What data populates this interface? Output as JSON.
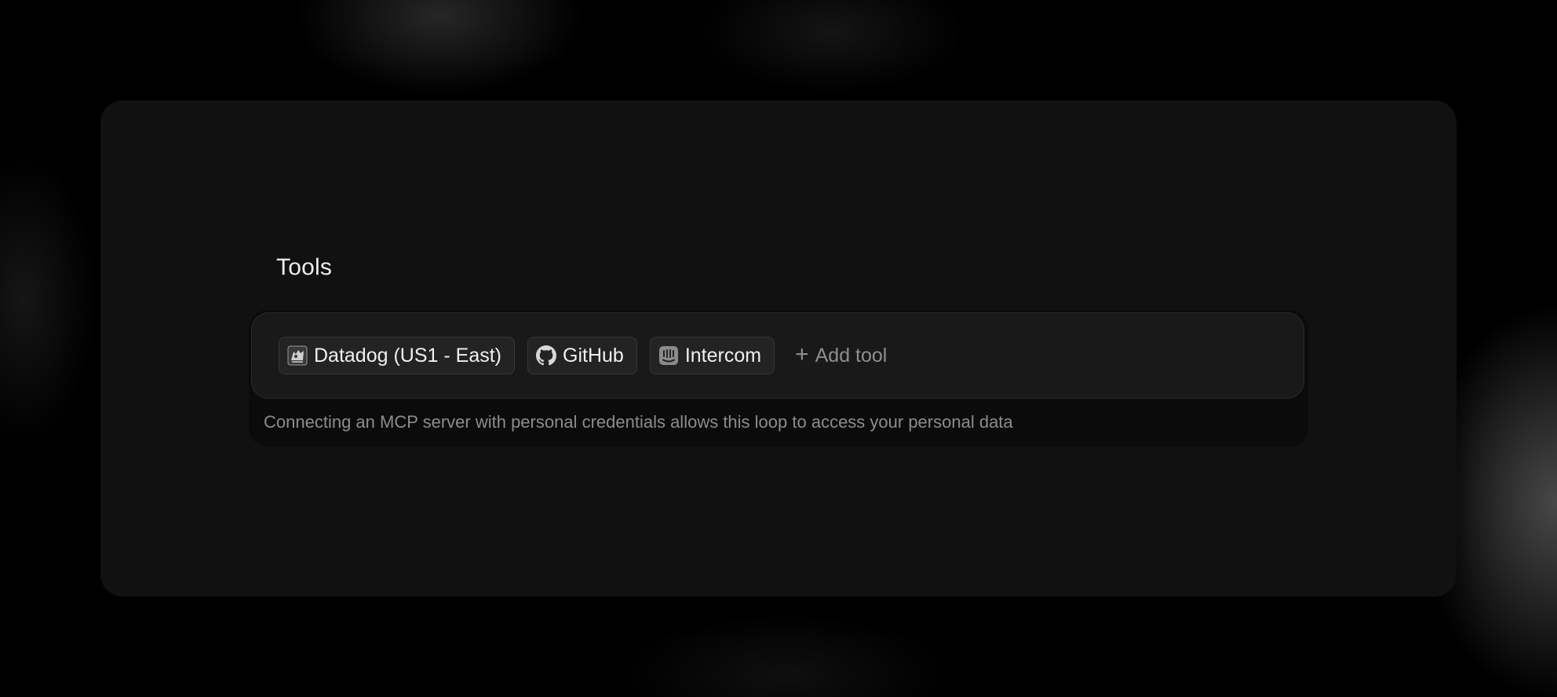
{
  "section": {
    "title": "Tools"
  },
  "tools": [
    {
      "label": "Datadog (US1 - East)",
      "icon": "datadog-icon"
    },
    {
      "label": "GitHub",
      "icon": "github-icon"
    },
    {
      "label": "Intercom",
      "icon": "intercom-icon"
    }
  ],
  "add_tool": {
    "label": "Add tool",
    "icon": "plus-icon"
  },
  "hint": "Connecting an MCP server with personal credentials allows this loop to access your personal data",
  "colors": {
    "page_background": "#000000",
    "panel_background": "#111111",
    "tools_box_background": "#191919",
    "chip_background": "#232323",
    "primary_text": "#f0f0f0",
    "muted_text": "#8c8c8c"
  }
}
